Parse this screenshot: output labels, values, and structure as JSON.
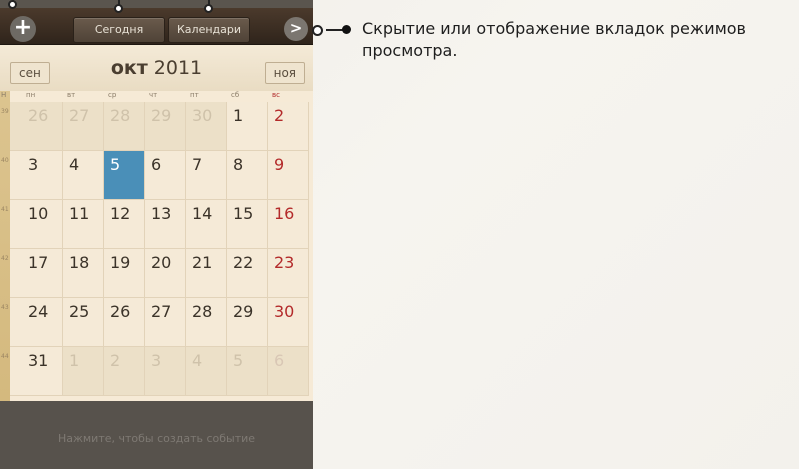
{
  "toolbar": {
    "add_icon": "+",
    "today_label": "Сегодня",
    "calendars_label": "Календари",
    "toggle_icon": ">"
  },
  "month_nav": {
    "prev_label": "сен",
    "next_label": "ноя",
    "month": "окт",
    "year": "2011"
  },
  "week_header": {
    "week_label": "Н",
    "days": [
      "пн",
      "вт",
      "ср",
      "чт",
      "пт",
      "сб",
      "вс"
    ]
  },
  "weeks": [
    {
      "number": "39",
      "days": [
        {
          "d": "26",
          "o": true
        },
        {
          "d": "27",
          "o": true
        },
        {
          "d": "28",
          "o": true
        },
        {
          "d": "29",
          "o": true
        },
        {
          "d": "30",
          "o": true
        },
        {
          "d": "1"
        },
        {
          "d": "2"
        }
      ]
    },
    {
      "number": "40",
      "days": [
        {
          "d": "3"
        },
        {
          "d": "4"
        },
        {
          "d": "5",
          "selected": true
        },
        {
          "d": "6"
        },
        {
          "d": "7"
        },
        {
          "d": "8"
        },
        {
          "d": "9"
        }
      ]
    },
    {
      "number": "41",
      "days": [
        {
          "d": "10"
        },
        {
          "d": "11"
        },
        {
          "d": "12"
        },
        {
          "d": "13"
        },
        {
          "d": "14"
        },
        {
          "d": "15"
        },
        {
          "d": "16"
        }
      ]
    },
    {
      "number": "42",
      "days": [
        {
          "d": "17"
        },
        {
          "d": "18"
        },
        {
          "d": "19"
        },
        {
          "d": "20"
        },
        {
          "d": "21"
        },
        {
          "d": "22"
        },
        {
          "d": "23"
        }
      ]
    },
    {
      "number": "43",
      "days": [
        {
          "d": "24"
        },
        {
          "d": "25"
        },
        {
          "d": "26"
        },
        {
          "d": "27"
        },
        {
          "d": "28"
        },
        {
          "d": "29"
        },
        {
          "d": "30"
        }
      ]
    },
    {
      "number": "44",
      "days": [
        {
          "d": "31"
        },
        {
          "d": "1",
          "o": true
        },
        {
          "d": "2",
          "o": true
        },
        {
          "d": "3",
          "o": true
        },
        {
          "d": "4",
          "o": true
        },
        {
          "d": "5",
          "o": true
        },
        {
          "d": "6",
          "o": true
        }
      ]
    }
  ],
  "events": {
    "hint": "Нажмите, чтобы создать событие"
  },
  "callout": {
    "text": "Скрытие или отображение вкладок режимов просмотра."
  },
  "colors": {
    "selected_day": "#4a8fb8",
    "sunday": "#b32a2a",
    "toolbar": "#3b2e23"
  }
}
